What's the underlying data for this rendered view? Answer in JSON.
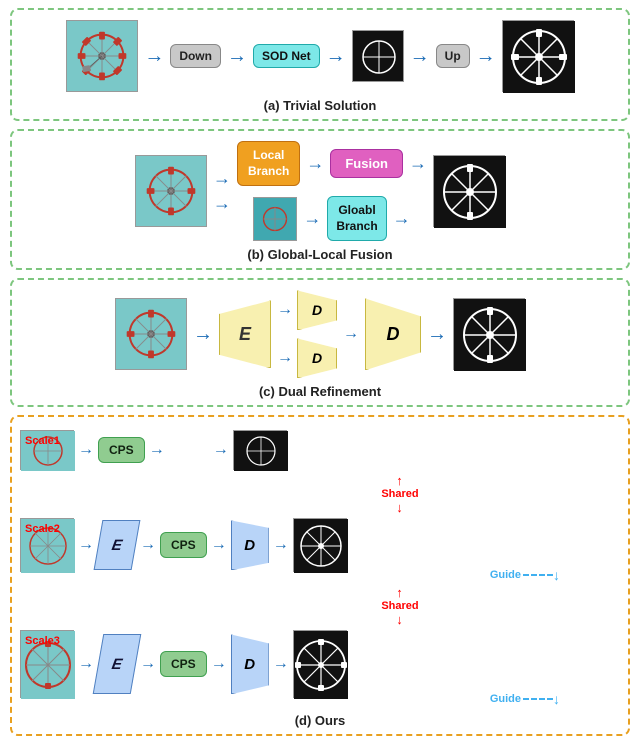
{
  "sections": {
    "a": {
      "label": "(a) Trivial Solution",
      "modules": [
        "Down",
        "SOD Net",
        "Up"
      ],
      "border_color": "#7dc67e"
    },
    "b": {
      "label": "(b) Global-Local Fusion",
      "local_branch": "Local\nBranch",
      "global_branch": "Gloabl\nBranch",
      "fusion": "Fusion",
      "border_color": "#7dc67e"
    },
    "c": {
      "label": "(c) Dual Refinement",
      "encoder": "E",
      "decoder_small": "D",
      "decoder_large": "D",
      "border_color": "#7dc67e"
    },
    "d": {
      "label": "(d) Ours",
      "scale1": "Scale1",
      "scale2": "Scale2",
      "scale3": "Scale3",
      "encoder": "E",
      "cps": "CPS",
      "decoder": "D",
      "shared": "Shared",
      "guide": "Guide",
      "border_color": "#e8a020"
    }
  }
}
